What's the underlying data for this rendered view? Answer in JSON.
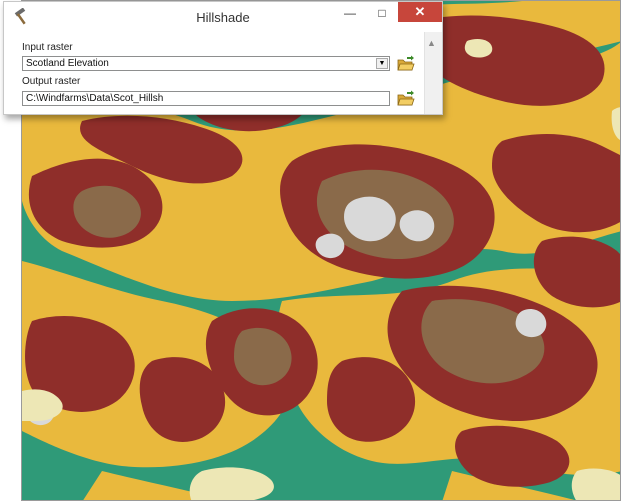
{
  "window": {
    "title": "Hillshade",
    "minimize_glyph": "—",
    "maximize_glyph": "□",
    "close_glyph": "✕"
  },
  "input_raster": {
    "label": "Input raster",
    "value": "Scotland Elevation"
  },
  "output_raster": {
    "label": "Output raster",
    "value": "C:\\Windfarms\\Data\\Scot_Hillsh"
  },
  "icons": {
    "app": "hammer-icon",
    "browse": "folder-open-icon",
    "dropdown": "dropdown-arrow-icon",
    "scroll": "scroll-up-icon"
  },
  "map_colors": {
    "lowland": "#2f9a78",
    "midland": "#e9b93d",
    "upland": "#8f2e2a",
    "high_upland": "#8a6a4a",
    "summit": "#d9d9d9",
    "water": "#ede7b5"
  }
}
